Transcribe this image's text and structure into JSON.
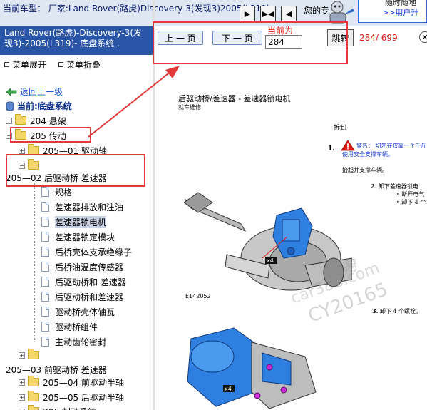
{
  "top": {
    "car_model_label": "当前车型：",
    "car_model_value": "厂家:Land Rover(路虎)Discovery-3(发现3)2005(L319)",
    "nav_buttons": [
      "▶",
      "▶◀",
      "◀"
    ],
    "your_label": "您的专",
    "user_line1": "随时随地",
    "user_link": ">>用户升"
  },
  "left": {
    "header": "Land Rover(路虎)-Discovery-3(发现3)-2005(L319)- 底盘系统 .",
    "expand_label": "菜单展开",
    "collapse_label": "菜单折叠",
    "back_label": "返回上一级",
    "current_label": "当前:底盘系统",
    "tree": [
      {
        "label": "204 悬架",
        "type": "folder",
        "pm": "+"
      },
      {
        "label": "205 传动",
        "type": "folder",
        "pm": "−"
      },
      {
        "label": "205—01 驱动轴",
        "type": "folder",
        "pm": "+"
      },
      {
        "label": "",
        "type": "folder",
        "pm": "−"
      },
      {
        "label": "205—02 后驱动桥 差速器",
        "type": "text"
      },
      {
        "label": "规格",
        "type": "doc"
      },
      {
        "label": "差速器排放和注油",
        "type": "doc"
      },
      {
        "label": "差速器锁电机",
        "type": "doc",
        "selected": true
      },
      {
        "label": "差速器锁定模块",
        "type": "doc"
      },
      {
        "label": "后桥壳体支承绝缘子",
        "type": "doc"
      },
      {
        "label": "后桥油温度传感器",
        "type": "doc"
      },
      {
        "label": "后驱动桥和 差速器",
        "type": "doc"
      },
      {
        "label": "后驱动桥和差速器",
        "type": "doc"
      },
      {
        "label": "驱动桥壳体轴瓦",
        "type": "doc"
      },
      {
        "label": "驱动桥组件",
        "type": "doc"
      },
      {
        "label": "主动齿轮密封",
        "type": "doc"
      },
      {
        "label": "",
        "type": "folder",
        "pm": "+"
      },
      {
        "label": "205—03 前驱动桥 差速器",
        "type": "text"
      },
      {
        "label": "205—04 前驱动半轴",
        "type": "folder",
        "pm": "+"
      },
      {
        "label": "205—05 后驱动半轴",
        "type": "folder",
        "pm": "+"
      },
      {
        "label": "206 制动系统",
        "type": "folder",
        "pm": "+"
      }
    ]
  },
  "toolbar": {
    "prev_label": "上 一 页",
    "next_label": "下 一 页",
    "current_label": "当前为",
    "page_value": "284",
    "jump_label": "跳转",
    "page_count": "284/ 699"
  },
  "document": {
    "title": "后驱动桥/差速器 - 差速器锁电机",
    "subtitle": "就车维修",
    "section_remove": "拆卸",
    "warning_label": "警告：",
    "warning_text": "切勿在仅靠一个千斤顶",
    "warning_text2": "使用安全支撑车辆。",
    "step1_num": "1.",
    "step1_text": "抬起并支撑车辆。",
    "step2_num": "2.",
    "step2_text": "卸下差速器锁电",
    "step2_sub1": "断开电气",
    "step2_sub2": "卸下 4 个",
    "step3_num": "3.",
    "step3_text": "卸下 4 个螺栓。",
    "figure_id": "E142052",
    "callout_x4": "x4",
    "watermark1": "car388.com",
    "watermark2": "CY20165",
    "watermark_small": "易"
  },
  "colors": {
    "left_header_bg": "#2a55a6",
    "accent_red": "#e01818",
    "link_blue": "#1a53c6"
  }
}
